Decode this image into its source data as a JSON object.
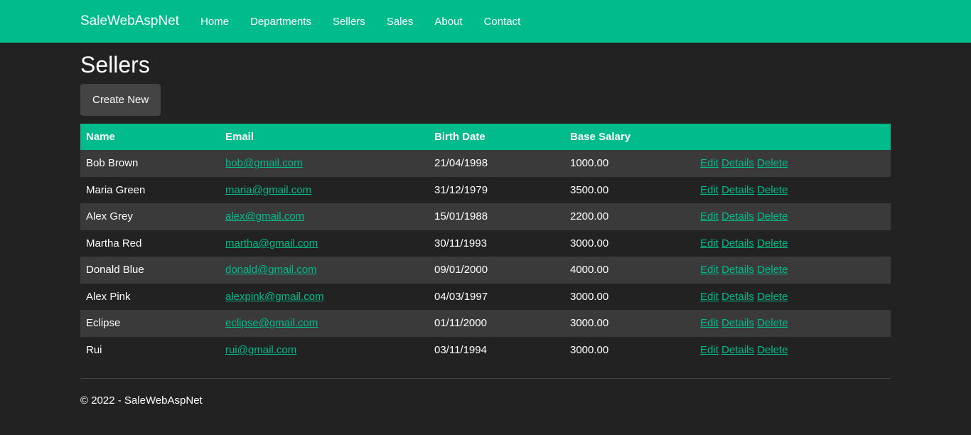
{
  "nav": {
    "brand": "SaleWebAspNet",
    "links": [
      "Home",
      "Departments",
      "Sellers",
      "Sales",
      "About",
      "Contact"
    ]
  },
  "page": {
    "title": "Sellers",
    "create_label": "Create New"
  },
  "table": {
    "headers": [
      "Name",
      "Email",
      "Birth Date",
      "Base Salary",
      ""
    ],
    "action_labels": [
      "Edit",
      "Details",
      "Delete"
    ],
    "rows": [
      {
        "name": "Bob Brown",
        "email": "bob@gmail.com",
        "birth": "21/04/1998",
        "salary": "1000.00"
      },
      {
        "name": "Maria Green",
        "email": "maria@gmail.com",
        "birth": "31/12/1979",
        "salary": "3500.00"
      },
      {
        "name": "Alex Grey",
        "email": "alex@gmail.com",
        "birth": "15/01/1988",
        "salary": "2200.00"
      },
      {
        "name": "Martha Red",
        "email": "martha@gmail.com",
        "birth": "30/11/1993",
        "salary": "3000.00"
      },
      {
        "name": "Donald Blue",
        "email": "donald@gmail.com",
        "birth": "09/01/2000",
        "salary": "4000.00"
      },
      {
        "name": "Alex Pink",
        "email": "alexpink@gmail.com",
        "birth": "04/03/1997",
        "salary": "3000.00"
      },
      {
        "name": "Eclipse",
        "email": "eclipse@gmail.com",
        "birth": "01/11/2000",
        "salary": "3000.00"
      },
      {
        "name": "Rui",
        "email": "rui@gmail.com",
        "birth": "03/11/1994",
        "salary": "3000.00"
      }
    ]
  },
  "footer": {
    "text": "© 2022 - SaleWebAspNet"
  },
  "colors": {
    "accent": "#00bc8c",
    "background": "#222222",
    "row_alt": "#3a3a3a"
  }
}
